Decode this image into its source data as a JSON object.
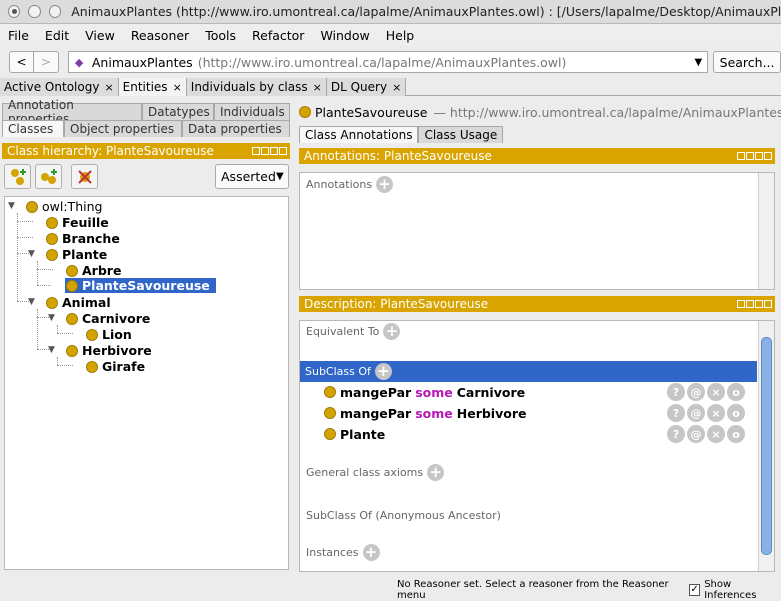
{
  "window": {
    "title": "AnimauxPlantes (http://www.iro.umontreal.ca/lapalme/AnimauxPlantes.owl)  : [/Users/lapalme/Desktop/AnimauxPlante..."
  },
  "menu": [
    "File",
    "Edit",
    "View",
    "Reasoner",
    "Tools",
    "Refactor",
    "Window",
    "Help"
  ],
  "nav": {
    "back": "<",
    "forward": ">",
    "ontology_name": "AnimauxPlantes",
    "ontology_iri": "(http://www.iro.umontreal.ca/lapalme/AnimauxPlantes.owl)",
    "search_label": "Search..."
  },
  "workspace_tabs": [
    {
      "label": "Active Ontology",
      "close": "×"
    },
    {
      "label": "Entities",
      "close": "×"
    },
    {
      "label": "Individuals by class",
      "close": "×"
    },
    {
      "label": "DL Query",
      "close": "×"
    }
  ],
  "left": {
    "subtabs_row1": [
      "Annotation properties",
      "Datatypes",
      "Individuals"
    ],
    "subtabs_row2": [
      "Classes",
      "Object properties",
      "Data properties"
    ],
    "hierarchy_title": "Class hierarchy: PlanteSavoureuse",
    "mode": "Asserted",
    "tree": {
      "root": "owl:Thing",
      "feuille": "Feuille",
      "branche": "Branche",
      "plante": "Plante",
      "arbre": "Arbre",
      "plantesavoureuse": "PlanteSavoureuse",
      "animal": "Animal",
      "carnivore": "Carnivore",
      "lion": "Lion",
      "herbivore": "Herbivore",
      "girafe": "Girafe"
    }
  },
  "right": {
    "class_name": "PlanteSavoureuse",
    "class_iri": "— http://www.iro.umontreal.ca/lapalme/AnimauxPlantes.owl#",
    "tabs": [
      "Class Annotations",
      "Class Usage"
    ],
    "annotations_title": "Annotations: PlanteSavoureuse",
    "annotations_label": "Annotations",
    "description_title": "Description: PlanteSavoureuse",
    "equivalent_to": "Equivalent To",
    "subclass_of": "SubClass Of",
    "axioms": [
      {
        "prop": "mangePar",
        "kw": "some",
        "filler": "Carnivore"
      },
      {
        "prop": "mangePar",
        "kw": "some",
        "filler": "Herbivore"
      },
      {
        "prop": "Plante",
        "kw": "",
        "filler": ""
      }
    ],
    "axiom_buttons": [
      "?",
      "@",
      "×",
      "o"
    ],
    "general_axioms": "General class axioms",
    "anon_ancestor": "SubClass Of (Anonymous Ancestor)",
    "instances": "Instances"
  },
  "status": {
    "message": "No Reasoner set. Select a reasoner from the Reasoner menu",
    "show_inferences": "Show Inferences",
    "check": "✓"
  },
  "colors": {
    "accent_yellow": "#d9a400",
    "selection_blue": "#2f66c8",
    "class_dot": "#d5a300",
    "keyword": "#b519b5"
  }
}
